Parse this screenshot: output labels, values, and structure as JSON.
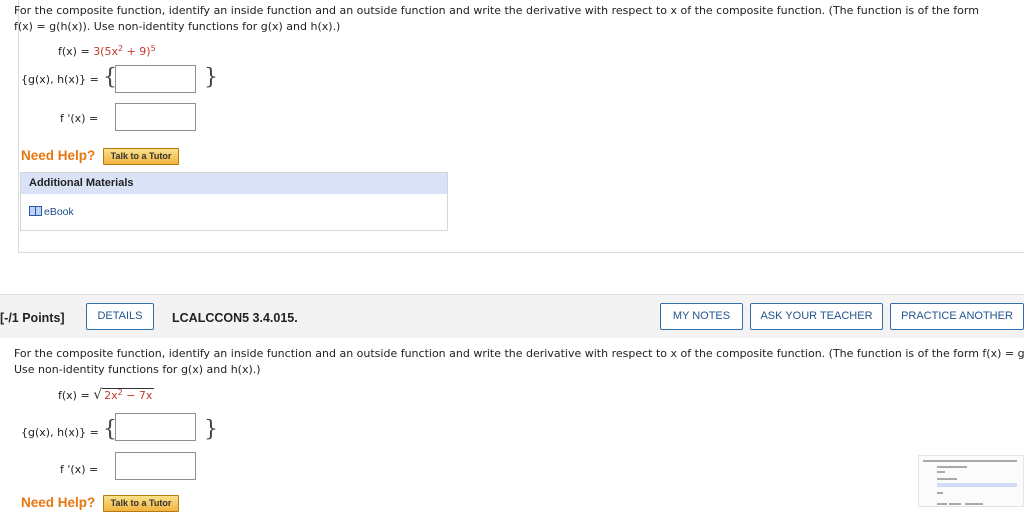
{
  "q1": {
    "prompt_line1": "For the composite function, identify an inside function and an outside function and write the derivative with respect to x of the composite function. (The function is of the form",
    "prompt_line2": "f(x) = g(h(x)). Use non-identity functions for g(x) and h(x).)",
    "function_lhs": "f(x) = ",
    "function_rhs_a": "3(5x",
    "function_rhs_exp1": "2",
    "function_rhs_b": " + 9)",
    "function_rhs_exp2": "5",
    "gh_label": "{g(x), h(x)} =",
    "fprime_label": "f '(x) ="
  },
  "help": {
    "need_help": "Need Help?",
    "tutor_button": "Talk to a Tutor"
  },
  "materials": {
    "header": "Additional Materials",
    "ebook": "eBook"
  },
  "q2_header": {
    "points": "[-/1 Points]",
    "details_button": "DETAILS",
    "question_id": "LCALCCON5 3.4.015.",
    "my_notes_button": "MY NOTES",
    "ask_teacher_button": "ASK YOUR TEACHER",
    "practice_button": "PRACTICE ANOTHER"
  },
  "q2": {
    "prompt_line1": "For the composite function, identify an inside function and an outside function and write the derivative with respect to x of the composite function. (The function is of the form  f(x) = g(h(x)).",
    "prompt_line2": "Use non-identity functions for g(x) and h(x).)",
    "function_lhs": "f(x) = ",
    "radicand_a": "2x",
    "radicand_exp": "2",
    "radicand_b": " − 7x",
    "gh_label": "{g(x), h(x)} =",
    "fprime_label": "f '(x) =",
    "need_help": "Need Help?",
    "tutor_button": "Talk to a Tutor"
  },
  "colors": {
    "accent_orange": "#e8760f",
    "button_blue": "#2f6fae",
    "panel_header": "#d9e2f7",
    "red_text": "#c0392b"
  }
}
